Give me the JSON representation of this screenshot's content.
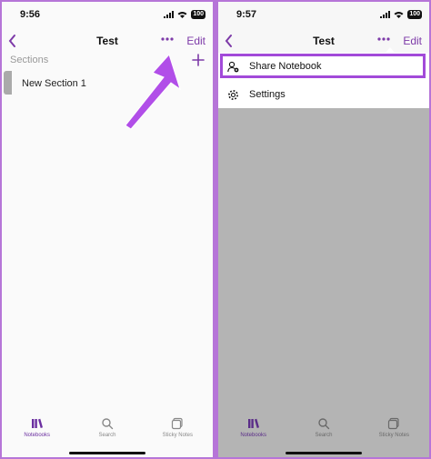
{
  "left": {
    "status": {
      "time": "9:56",
      "battery": "100"
    },
    "nav": {
      "title": "Test",
      "edit": "Edit"
    },
    "sections_label": "Sections",
    "section_item": "New Section 1"
  },
  "right": {
    "status": {
      "time": "9:57",
      "battery": "100"
    },
    "nav": {
      "title": "Test",
      "edit": "Edit"
    },
    "menu": {
      "share": "Share Notebook",
      "settings": "Settings"
    }
  },
  "tabs": {
    "notebooks": "Notebooks",
    "search": "Search",
    "sticky": "Sticky Notes"
  },
  "colors": {
    "accent": "#7d3aa8",
    "highlight": "#a24ad9",
    "arrow": "#b14ee8",
    "overlay": "#b4b4b4"
  },
  "icons": [
    "back-chevron-icon",
    "more-icon",
    "plus-icon",
    "notebooks-icon",
    "search-icon",
    "sticky-notes-icon",
    "share-person-icon",
    "gear-icon",
    "annotation-arrow"
  ]
}
